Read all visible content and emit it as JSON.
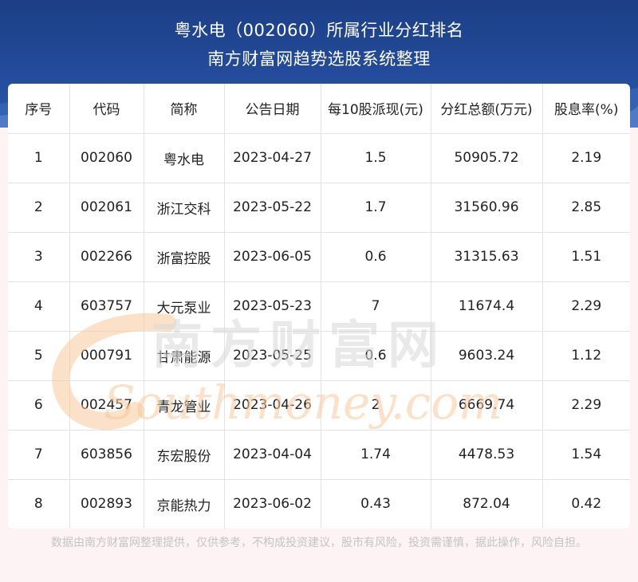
{
  "header": {
    "title": "粤水电（002060）所属行业分红排名",
    "subtitle": "南方财富网趋势选股系统整理"
  },
  "table": {
    "columns": [
      "序号",
      "代码",
      "简称",
      "公告日期",
      "每10股派现(元)",
      "分红总额(万元)",
      "股息率(%)"
    ],
    "rows": [
      [
        "1",
        "002060",
        "粤水电",
        "2023-04-27",
        "1.5",
        "50905.72",
        "2.19"
      ],
      [
        "2",
        "002061",
        "浙江交科",
        "2023-05-22",
        "1.7",
        "31560.96",
        "2.85"
      ],
      [
        "3",
        "002266",
        "浙富控股",
        "2023-06-05",
        "0.6",
        "31315.63",
        "1.51"
      ],
      [
        "4",
        "603757",
        "大元泵业",
        "2023-05-23",
        "7",
        "11674.4",
        "2.29"
      ],
      [
        "5",
        "000791",
        "甘肃能源",
        "2023-05-25",
        "0.6",
        "9603.24",
        "1.12"
      ],
      [
        "6",
        "002457",
        "青龙管业",
        "2023-04-26",
        "2",
        "6669.74",
        "2.29"
      ],
      [
        "7",
        "603856",
        "东宏股份",
        "2023-04-04",
        "1.74",
        "4478.53",
        "1.54"
      ],
      [
        "8",
        "002893",
        "京能热力",
        "2023-06-02",
        "0.43",
        "872.04",
        "0.42"
      ]
    ]
  },
  "watermark": {
    "cn": "南方财富网",
    "en": "Southmoney.com"
  },
  "footer": {
    "disclaimer": "数据由南方财富网整理提供，仅供参考，不构成投资建议，股市有风险，投资需谨慎，据此操作，风险自担。"
  },
  "colors": {
    "header_bg": "#234b9a",
    "page_bg": "#fdf3f5",
    "watermark_orange": "#f6c99a"
  }
}
